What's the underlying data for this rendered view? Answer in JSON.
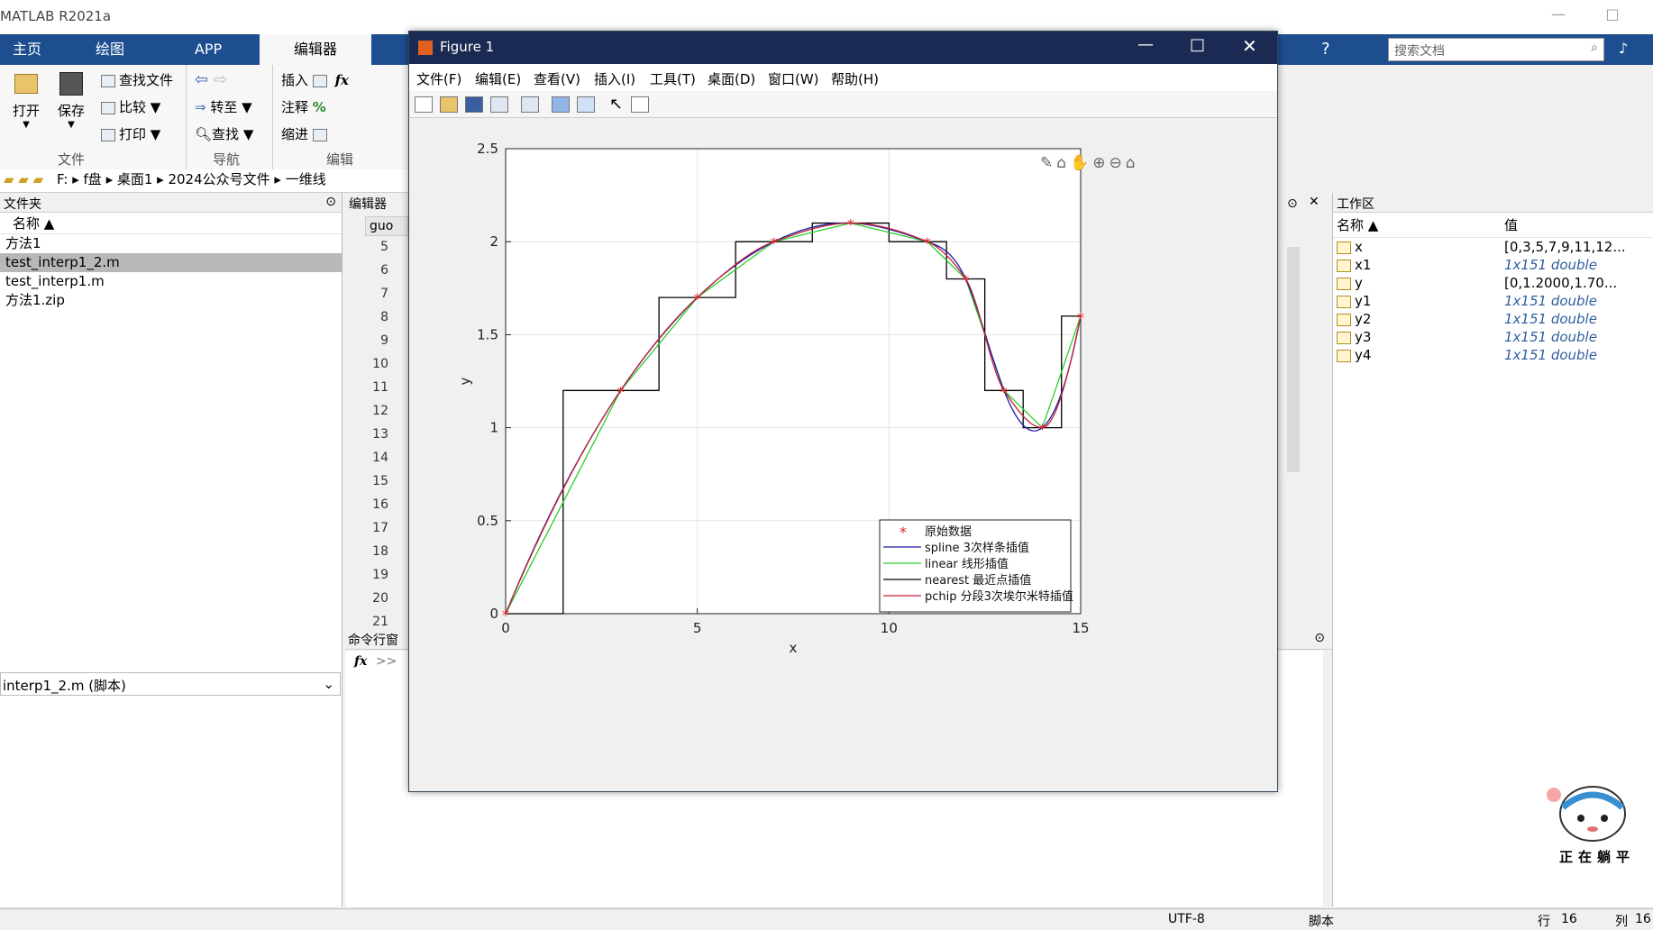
{
  "app": {
    "title": "MATLAB R2021a",
    "window_controls": [
      "—",
      "□"
    ]
  },
  "ribbon": {
    "tabs": [
      "主页",
      "绘图",
      "APP",
      "编辑器"
    ],
    "file": {
      "open": "打开",
      "save": "保存",
      "find_files": "查找文件",
      "compare": "比较",
      "print": "打印",
      "group": "文件"
    },
    "nav": {
      "goto": "转至",
      "find": "查找",
      "group": "导航"
    },
    "edit": {
      "insert": "插入",
      "comment": "注释",
      "indent": "缩进",
      "group": "编辑"
    }
  },
  "search": {
    "placeholder": "搜索文档"
  },
  "address": {
    "path": "F: ▸ f盘 ▸ 桌面1 ▸ 2024公众号文件 ▸ 一维线"
  },
  "folder_panel": {
    "title": "文件夹",
    "column": "名称 ▲",
    "files": [
      "方法1",
      "test_interp1_2.m",
      "test_interp1.m",
      "方法1.zip"
    ],
    "selected": "test_interp1_2.m",
    "detail": "interp1_2.m (脚本)"
  },
  "editor": {
    "tab_label": "编辑器",
    "file_tab": "guo",
    "line_numbers": [
      "5",
      "6",
      "7",
      "8",
      "9",
      "10",
      "11",
      "12",
      "13",
      "14",
      "15",
      "16",
      "17",
      "18",
      "19",
      "20",
      "21"
    ]
  },
  "command_window": {
    "title": "命令行窗",
    "fx": "fx",
    "prompt": ">>"
  },
  "workspace": {
    "title": "工作区",
    "col_name": "名称 ▲",
    "col_value": "值",
    "vars": [
      {
        "name": "x",
        "value": "[0,3,5,7,9,11,12...",
        "italic": false
      },
      {
        "name": "x1",
        "value": "1x151 double",
        "italic": true
      },
      {
        "name": "y",
        "value": "[0,1.2000,1.70...",
        "italic": false
      },
      {
        "name": "y1",
        "value": "1x151 double",
        "italic": true
      },
      {
        "name": "y2",
        "value": "1x151 double",
        "italic": true
      },
      {
        "name": "y3",
        "value": "1x151 double",
        "italic": true
      },
      {
        "name": "y4",
        "value": "1x151 double",
        "italic": true
      }
    ]
  },
  "status": {
    "encoding": "UTF-8",
    "mode": "脚本",
    "row_label": "行",
    "row": "16",
    "col_label": "列",
    "col": "16"
  },
  "figure": {
    "title": "Figure 1",
    "menus": [
      "文件(F)",
      "编辑(E)",
      "查看(V)",
      "插入(I)",
      "工具(T)",
      "桌面(D)",
      "窗口(W)",
      "帮助(H)"
    ]
  },
  "mascot_text": "正在躺平",
  "colors": {
    "data": "#e02020",
    "spline": "#1a1aa8",
    "linear": "#2ecc2e",
    "nearest": "#000000",
    "pchip": "#c0203a"
  },
  "chart_data": {
    "type": "line",
    "xlabel": "x",
    "ylabel": "y",
    "xlim": [
      0,
      15
    ],
    "ylim": [
      0,
      2.5
    ],
    "xticks": [
      "0",
      "5",
      "10",
      "15"
    ],
    "yticks": [
      "0",
      "0.5",
      "1",
      "1.5",
      "2",
      "2.5"
    ],
    "grid": true,
    "legend_position": "bottom-right",
    "x": [
      0,
      3,
      5,
      7,
      9,
      11,
      12,
      13,
      14,
      15
    ],
    "y": [
      0,
      1.2,
      1.7,
      2.0,
      2.1,
      2.0,
      1.8,
      1.2,
      1.0,
      1.6
    ],
    "series": [
      {
        "name": "原始数据",
        "style": "marker"
      },
      {
        "name": "spline 3次样条插值",
        "style": "line"
      },
      {
        "name": "linear 线形插值",
        "style": "line"
      },
      {
        "name": "nearest 最近点插值",
        "style": "step"
      },
      {
        "name": "pchip 分段3次埃尔米特插值",
        "style": "line"
      }
    ]
  }
}
